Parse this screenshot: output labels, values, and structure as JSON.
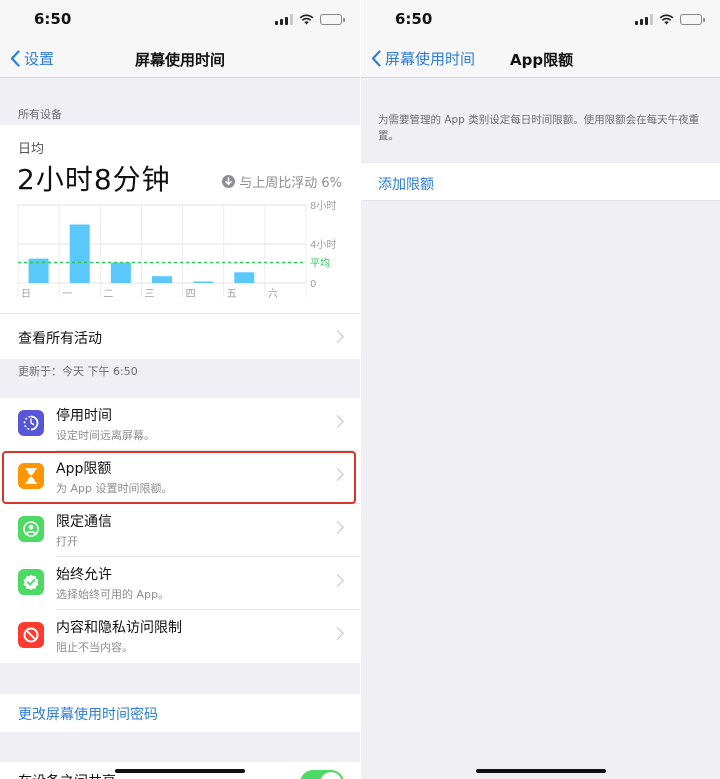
{
  "status": {
    "time": "6:50"
  },
  "left": {
    "nav": {
      "back_label": "设置",
      "title": "屏幕使用时间"
    },
    "all_devices_header": "所有设备",
    "summary": {
      "period_label": "日均",
      "total_time": "2小时8分钟",
      "compare_text": "与上周比浮动 6%"
    },
    "chart_data": {
      "type": "bar",
      "categories": [
        "日",
        "一",
        "二",
        "三",
        "四",
        "五",
        "六"
      ],
      "values": [
        2.5,
        6.0,
        2.1,
        0.7,
        0.1,
        1.1,
        0
      ],
      "y_tick_labels": [
        "8小时",
        "4小时",
        "0"
      ],
      "ylim": [
        0,
        8
      ],
      "average_label": "平均",
      "average_value": 2.1,
      "bar_color": "#5ac8fa",
      "average_color": "#34c759"
    },
    "see_all_activity": "查看所有活动",
    "updated_text": "更新于：今天 下午 6:50",
    "menu": [
      {
        "title": "停用时间",
        "subtitle": "设定时间远离屏幕。",
        "icon": "downtime-icon",
        "color": "#5856d6"
      },
      {
        "title": "App限额",
        "subtitle": "为 App 设置时间限额。",
        "icon": "hourglass-icon",
        "color": "#ff9500"
      },
      {
        "title": "限定通信",
        "subtitle": "打开",
        "icon": "contact-icon",
        "color": "#4cd964"
      },
      {
        "title": "始终允许",
        "subtitle": "选择始终可用的 App。",
        "icon": "checkmark-badge-icon",
        "color": "#4cd964"
      },
      {
        "title": "内容和隐私访问限制",
        "subtitle": "阻止不当内容。",
        "icon": "block-icon",
        "color": "#ff3b30"
      }
    ],
    "change_passcode": "更改屏幕使用时间密码",
    "share_across_devices": "在设备之间共享"
  },
  "right": {
    "nav": {
      "back_label": "屏幕使用时间",
      "title": "App限额"
    },
    "description": "为需要管理的 App 类别设定每日时间限额。使用限额会在每天午夜重置。",
    "add_limit": "添加限额"
  }
}
